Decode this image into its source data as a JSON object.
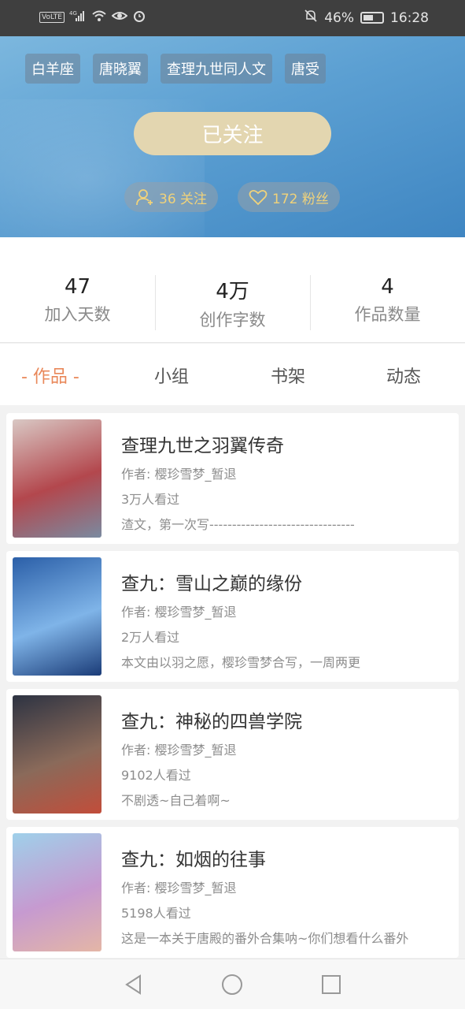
{
  "status_bar": {
    "volte": "VoLTE",
    "network": "4G",
    "battery": "46%",
    "time": "16:28"
  },
  "profile": {
    "tags": [
      "白羊座",
      "唐晓翼",
      "查理九世同人文",
      "唐受"
    ],
    "follow_button": "已关注",
    "following": "36 关注",
    "fans": "172 粉丝"
  },
  "stats": [
    {
      "value": "47",
      "label": "加入天数"
    },
    {
      "value": "4万",
      "label": "创作字数"
    },
    {
      "value": "4",
      "label": "作品数量"
    }
  ],
  "tabs": [
    {
      "label": "- 作品 -",
      "active": true
    },
    {
      "label": "小组",
      "active": false
    },
    {
      "label": "书架",
      "active": false
    },
    {
      "label": "动态",
      "active": false
    }
  ],
  "works": [
    {
      "title": "查理九世之羽翼传奇",
      "author": "作者: 樱珍雪梦_暂退",
      "views": "3万人看过",
      "desc": "渣文，第一次写--------------------------------",
      "cover_colors": [
        "#d9c8c4",
        "#b3474d",
        "#7a8aa0"
      ]
    },
    {
      "title": "查九：雪山之巅的缘份",
      "author": "作者: 樱珍雪梦_暂退",
      "views": "2万人看过",
      "desc": "本文由以羽之愿，樱珍雪梦合写，一周两更",
      "cover_colors": [
        "#2b5fa8",
        "#7fb4e8",
        "#1b3c78"
      ]
    },
    {
      "title": "查九：神秘的四兽学院",
      "author": "作者: 樱珍雪梦_暂退",
      "views": "9102人看过",
      "desc": "不剧透~自己着啊~",
      "cover_colors": [
        "#2d3342",
        "#8a6a5a",
        "#c24d3a"
      ]
    },
    {
      "title": "查九：如烟的往事",
      "author": "作者: 樱珍雪梦_暂退",
      "views": "5198人看过",
      "desc": "这是一本关于唐殿的番外合集呐~你们想看什么番外",
      "cover_colors": [
        "#9fd0ea",
        "#c69ad0",
        "#e4b6a6"
      ]
    }
  ],
  "colors": {
    "accent": "#e9885a",
    "follow_btn": "#e3d6b0",
    "pill_text": "#f0d27a"
  }
}
